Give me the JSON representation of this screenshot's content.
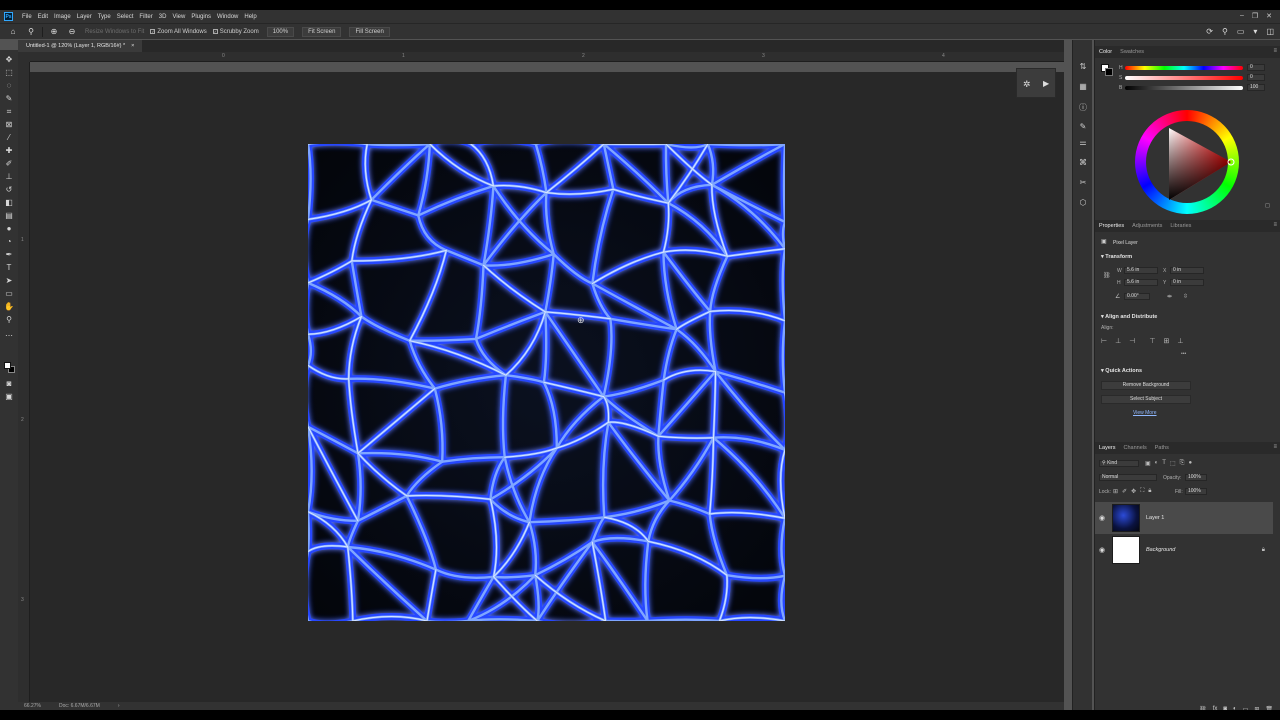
{
  "menubar": {
    "app_logo": "Ps",
    "items": [
      "File",
      "Edit",
      "Image",
      "Layer",
      "Type",
      "Select",
      "Filter",
      "3D",
      "View",
      "Plugins",
      "Window",
      "Help"
    ],
    "window_controls": [
      "–",
      "❐",
      "✕"
    ]
  },
  "options": {
    "resize_windows": "Resize Windows to Fit",
    "zoom_all": "Zoom All Windows",
    "scrubby_zoom": "Scrubby Zoom",
    "zoom_100": "100%",
    "fit_screen": "Fit Screen",
    "fill_screen": "Fill Screen"
  },
  "document": {
    "tab_title": "Untitled-1 @ 120% (Layer 1, RGB/16#) *",
    "close": "×"
  },
  "rulers": {
    "top": [
      "0",
      "1",
      "2",
      "3",
      "4"
    ],
    "left": [
      "1",
      "2",
      "3"
    ]
  },
  "status": {
    "zoom": "66.27%",
    "doc_info": "Doc: 6.67M/6.67M",
    "arrow": "›"
  },
  "color_panel": {
    "tabs": [
      "Color",
      "Swatches"
    ],
    "values": [
      "0",
      "0",
      "100"
    ],
    "channel_labels": [
      "H",
      "S",
      "B"
    ],
    "colors": {
      "hue_marker": "#ff1a1a",
      "fg": "#ffffff",
      "bg": "#000000"
    }
  },
  "properties_panel": {
    "tabs": [
      "Properties",
      "Adjustments",
      "Libraries"
    ],
    "kind": "Pixel Layer",
    "transform_head": "Transform",
    "w_label": "W",
    "w_value": "5.6 in",
    "h_label": "H",
    "h_value": "5.6 in",
    "x_label": "X",
    "x_value": "0 in",
    "y_label": "Y",
    "y_value": "0 in",
    "angle_value": "0.00°",
    "align_head": "Align and Distribute",
    "align_label": "Align:",
    "more": "•••",
    "quick_actions_head": "Quick Actions",
    "remove_bg": "Remove Background",
    "select_subject": "Select Subject",
    "view_more": "View More"
  },
  "layers_panel": {
    "tabs": [
      "Layers",
      "Channels",
      "Paths"
    ],
    "filter_kind": "Kind",
    "blend_mode": "Normal",
    "opacity_label": "Opacity:",
    "opacity_value": "100%",
    "lock_label": "Lock:",
    "fill_label": "Fill:",
    "fill_value": "100%",
    "layers": [
      {
        "name": "Layer 1",
        "selected": true
      },
      {
        "name": "Background",
        "selected": false
      }
    ]
  }
}
